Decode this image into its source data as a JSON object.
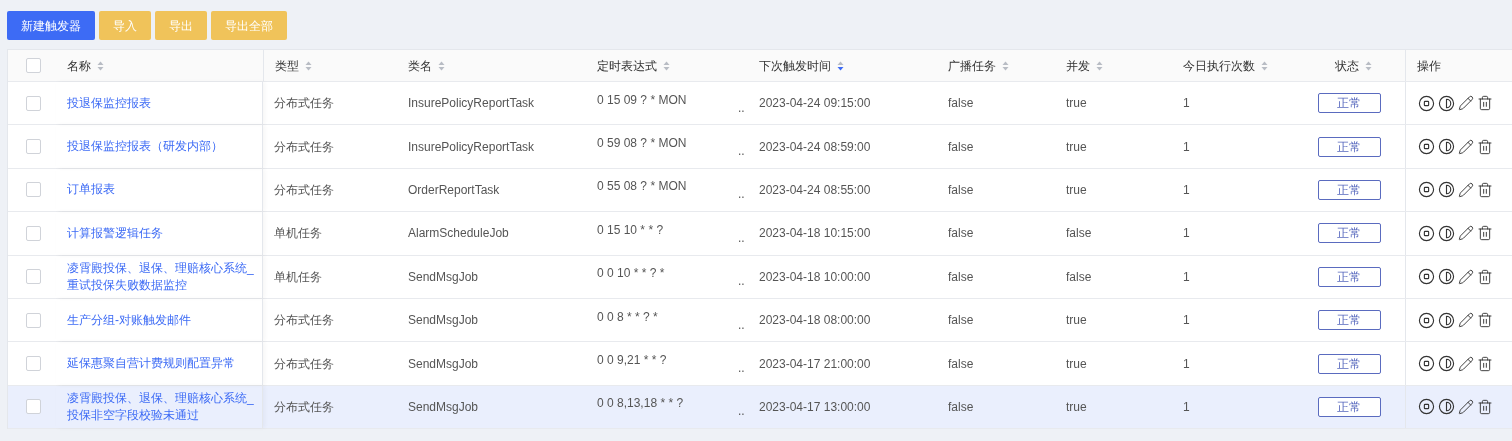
{
  "toolbar": [
    {
      "label": "新建触发器",
      "kind": "primary"
    },
    {
      "label": "导入",
      "kind": "warning"
    },
    {
      "label": "导出",
      "kind": "warning"
    },
    {
      "label": "导出全部",
      "kind": "warning"
    }
  ],
  "table": {
    "all_checked": false,
    "columns": [
      {
        "label": "名称",
        "sortable": true,
        "sorted": false
      },
      {
        "label": "类型",
        "sortable": true,
        "sorted": false
      },
      {
        "label": "类名",
        "sortable": true,
        "sorted": false
      },
      {
        "label": "定时表达式",
        "sortable": true,
        "sorted": false
      },
      {
        "label": "下次触发时间",
        "sortable": true,
        "sorted": true
      },
      {
        "label": "广播任务",
        "sortable": true,
        "sorted": false
      },
      {
        "label": "并发",
        "sortable": true,
        "sorted": false
      },
      {
        "label": "今日执行次数",
        "sortable": true,
        "sorted": false
      },
      {
        "label": "状态",
        "sortable": true,
        "sorted": false
      },
      {
        "label": "操作"
      }
    ],
    "rows": [
      {
        "checked": false,
        "highlighted": false,
        "name": "投退保监控报表",
        "type": "分布式任务",
        "class_name": "InsurePolicyReportTask",
        "cron": "0 15 09 ? * MON",
        "column_5": "..",
        "next_time": "2023-04-24 09:15:00",
        "broadcast": "false",
        "concurrent": "true",
        "today_count": "1",
        "status": "正常"
      },
      {
        "checked": false,
        "highlighted": false,
        "name": "投退保监控报表（研发内部）",
        "type": "分布式任务",
        "class_name": "InsurePolicyReportTask",
        "cron": "0 59 08 ? * MON",
        "column_5": "..",
        "next_time": "2023-04-24 08:59:00",
        "broadcast": "false",
        "concurrent": "true",
        "today_count": "1",
        "status": "正常"
      },
      {
        "checked": false,
        "highlighted": false,
        "name": "订单报表",
        "type": "分布式任务",
        "class_name": "OrderReportTask",
        "cron": "0 55 08 ? * MON",
        "column_5": "..",
        "next_time": "2023-04-24 08:55:00",
        "broadcast": "false",
        "concurrent": "true",
        "today_count": "1",
        "status": "正常"
      },
      {
        "checked": false,
        "highlighted": false,
        "name": "计算报警逻辑任务",
        "type": "单机任务",
        "class_name": "AlarmScheduleJob",
        "cron": "0 15 10 * * ?",
        "column_5": "..",
        "next_time": "2023-04-18 10:15:00",
        "broadcast": "false",
        "concurrent": "false",
        "today_count": "1",
        "status": "正常"
      },
      {
        "checked": false,
        "highlighted": false,
        "name": "凌霄殿投保、退保、理赔核心系统_重试投保失败数据监控",
        "type": "单机任务",
        "class_name": "SendMsgJob",
        "cron": "0 0 10 * * ? *",
        "column_5": "..",
        "next_time": "2023-04-18 10:00:00",
        "broadcast": "false",
        "concurrent": "false",
        "today_count": "1",
        "status": "正常"
      },
      {
        "checked": false,
        "highlighted": false,
        "name": "生产分组-对账触发邮件",
        "type": "分布式任务",
        "class_name": "SendMsgJob",
        "cron": "0 0 8 * * ? *",
        "column_5": "..",
        "next_time": "2023-04-18 08:00:00",
        "broadcast": "false",
        "concurrent": "true",
        "today_count": "1",
        "status": "正常"
      },
      {
        "checked": false,
        "highlighted": false,
        "name": "延保惠聚自营计费规则配置异常",
        "type": "分布式任务",
        "class_name": "SendMsgJob",
        "cron": "0 0 9,21 * * ?",
        "column_5": "..",
        "next_time": "2023-04-17 21:00:00",
        "broadcast": "false",
        "concurrent": "true",
        "today_count": "1",
        "status": "正常"
      },
      {
        "checked": false,
        "highlighted": true,
        "name": "凌霄殿投保、退保、理赔核心系统_投保非空字段校验未通过",
        "type": "分布式任务",
        "class_name": "SendMsgJob",
        "cron": "0 0 8,13,18 * * ?",
        "column_5": "..",
        "next_time": "2023-04-17 13:00:00",
        "broadcast": "false",
        "concurrent": "true",
        "today_count": "1",
        "status": "正常"
      }
    ]
  }
}
